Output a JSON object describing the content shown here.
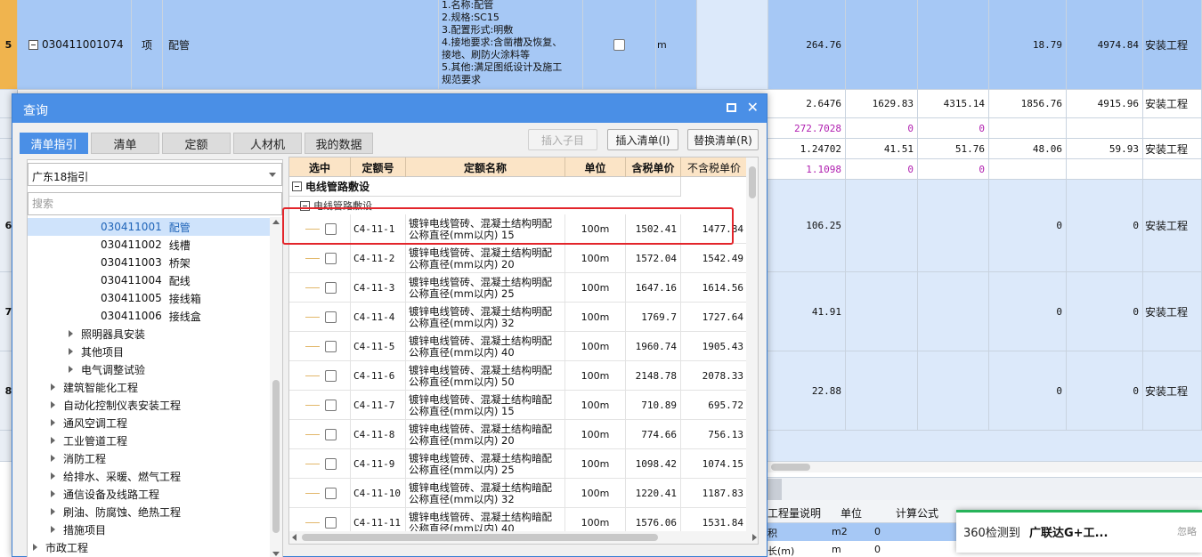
{
  "background": {
    "row5": {
      "num": "5",
      "code": "030411001074",
      "unit_type": "项",
      "name": "配管",
      "desc_lines": [
        "1.名称:配管",
        "2.规格:SC15",
        "3.配置形式:明敷",
        "4.接地要求:含凿槽及恢复、",
        "接地、刷防火涂料等",
        "5.其他:满足图纸设计及施工",
        "规范要求"
      ],
      "unit": "m",
      "qty": "264.76",
      "price": "18.79",
      "total": "4974.84",
      "category": "安装工程"
    },
    "sub_rows": [
      {
        "c1": "2.6476",
        "c2": "1629.83",
        "c3": "4315.14",
        "c4": "1856.76",
        "c5": "4915.96",
        "cat": "安装工程"
      },
      {
        "c1": "272.7028",
        "c2": "0",
        "c3": "0",
        "c4": "",
        "c5": "",
        "cat": ""
      },
      {
        "c1": "1.24702",
        "c2": "41.51",
        "c3": "51.76",
        "c4": "48.06",
        "c5": "59.93",
        "cat": "安装工程"
      },
      {
        "c1": "1.1098",
        "c2": "0",
        "c3": "0",
        "c4": "",
        "c5": "",
        "cat": ""
      }
    ],
    "row6": {
      "num": "6",
      "qty": "106.25",
      "price": "0",
      "total": "0",
      "category": "安装工程"
    },
    "row7": {
      "num": "7",
      "qty": "41.91",
      "price": "0",
      "total": "0",
      "category": "安装工程"
    },
    "row8": {
      "num": "8",
      "qty": "22.88",
      "price": "0",
      "total": "0",
      "category": "安装工程"
    },
    "bottom": {
      "h1": "工程量说明",
      "h2": "单位",
      "h3": "计算公式",
      "r1c1": "积",
      "r1c2": "m2",
      "r1c3": "0",
      "r2c1": "长(m)",
      "r2c2": "m",
      "r2c3": "0"
    }
  },
  "toast": {
    "prefix": "360检测到",
    "app": "广联达G+工...",
    "ignore": "忽略"
  },
  "dialog": {
    "title": "查询",
    "tabs": [
      "清单指引",
      "清单",
      "定额",
      "人材机",
      "我的数据"
    ],
    "buttons": {
      "insert_child": "插入子目",
      "insert_list": "插入清单(I)",
      "replace_list": "替换清单(R)"
    },
    "dropdown_value": "广东18指引",
    "search_placeholder": "搜索",
    "tree": [
      {
        "code": "030411001",
        "name": "配管"
      },
      {
        "code": "030411002",
        "name": "线槽"
      },
      {
        "code": "030411003",
        "name": "桥架"
      },
      {
        "code": "030411004",
        "name": "配线"
      },
      {
        "code": "030411005",
        "name": "接线箱"
      },
      {
        "code": "030411006",
        "name": "接线盒"
      },
      {
        "name": "照明器具安装"
      },
      {
        "name": "其他项目"
      },
      {
        "name": "电气调整试验"
      },
      {
        "name": "建筑智能化工程"
      },
      {
        "name": "自动化控制仪表安装工程"
      },
      {
        "name": "通风空调工程"
      },
      {
        "name": "工业管道工程"
      },
      {
        "name": "消防工程"
      },
      {
        "name": "给排水、采暖、燃气工程"
      },
      {
        "name": "通信设备及线路工程"
      },
      {
        "name": "刷油、防腐蚀、绝热工程"
      },
      {
        "name": "措施项目"
      },
      {
        "name": "市政工程"
      }
    ],
    "table": {
      "headers": [
        "选中",
        "定额号",
        "定额名称",
        "单位",
        "含税单价",
        "不含税单价"
      ],
      "group1": "电线管路敷设",
      "group2": "电线管路敷设",
      "rows": [
        {
          "code": "C4-11-1",
          "name": "镀锌电线管砖、混凝土结构明配 公称直径(mm以内) 15",
          "unit": "100m",
          "tax": "1502.41",
          "notax": "1477.84"
        },
        {
          "code": "C4-11-2",
          "name": "镀锌电线管砖、混凝土结构明配 公称直径(mm以内) 20",
          "unit": "100m",
          "tax": "1572.04",
          "notax": "1542.49"
        },
        {
          "code": "C4-11-3",
          "name": "镀锌电线管砖、混凝土结构明配 公称直径(mm以内) 25",
          "unit": "100m",
          "tax": "1647.16",
          "notax": "1614.56"
        },
        {
          "code": "C4-11-4",
          "name": "镀锌电线管砖、混凝土结构明配 公称直径(mm以内) 32",
          "unit": "100m",
          "tax": "1769.7",
          "notax": "1727.64"
        },
        {
          "code": "C4-11-5",
          "name": "镀锌电线管砖、混凝土结构明配 公称直径(mm以内) 40",
          "unit": "100m",
          "tax": "1960.74",
          "notax": "1905.43"
        },
        {
          "code": "C4-11-6",
          "name": "镀锌电线管砖、混凝土结构明配 公称直径(mm以内) 50",
          "unit": "100m",
          "tax": "2148.78",
          "notax": "2078.33"
        },
        {
          "code": "C4-11-7",
          "name": "镀锌电线管砖、混凝土结构暗配 公称直径(mm以内) 15",
          "unit": "100m",
          "tax": "710.89",
          "notax": "695.72"
        },
        {
          "code": "C4-11-8",
          "name": "镀锌电线管砖、混凝土结构暗配 公称直径(mm以内) 20",
          "unit": "100m",
          "tax": "774.66",
          "notax": "756.13"
        },
        {
          "code": "C4-11-9",
          "name": "镀锌电线管砖、混凝土结构暗配 公称直径(mm以内) 25",
          "unit": "100m",
          "tax": "1098.42",
          "notax": "1074.15"
        },
        {
          "code": "C4-11-10",
          "name": "镀锌电线管砖、混凝土结构暗配 公称直径(mm以内) 32",
          "unit": "100m",
          "tax": "1220.41",
          "notax": "1187.83"
        },
        {
          "code": "C4-11-11",
          "name": "镀锌电线管砖、混凝土结构暗配 公称直径(mm以内) 40",
          "unit": "100m",
          "tax": "1576.06",
          "notax": "1531.84"
        }
      ]
    }
  }
}
